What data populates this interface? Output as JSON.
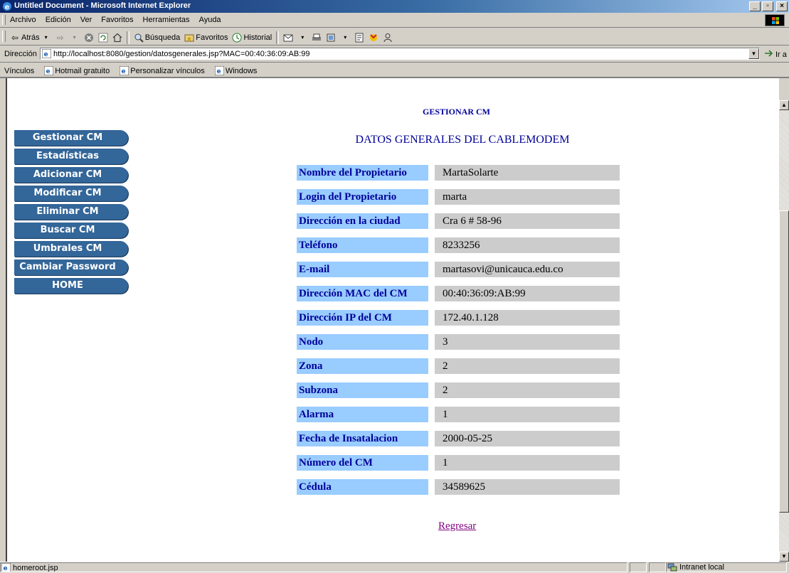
{
  "window": {
    "title": "Untitled Document - Microsoft Internet Explorer",
    "controls": [
      "_",
      "▫",
      "×"
    ]
  },
  "menu": {
    "items": [
      "Archivo",
      "Edición",
      "Ver",
      "Favoritos",
      "Herramientas",
      "Ayuda"
    ]
  },
  "toolbar": {
    "back_label": "Atrás",
    "search_label": "Búsqueda",
    "favorites_label": "Favoritos",
    "history_label": "Historial"
  },
  "address": {
    "label": "Dirección",
    "url": "http://localhost:8080/gestion/datosgenerales.jsp?MAC=00:40:36:09:AB:99",
    "go_label": "Ir a"
  },
  "links": {
    "label": "Vínculos",
    "items": [
      "Hotmail gratuito",
      "Personalizar vínculos",
      "Windows"
    ]
  },
  "nav": {
    "items": [
      "Gestionar CM",
      "Estadísticas",
      "Adicionar CM",
      "Modificar CM",
      "Eliminar CM",
      "Buscar CM",
      "Umbrales CM",
      "Cambiar Password",
      "HOME"
    ]
  },
  "main": {
    "section_title": "GESTIONAR CM",
    "heading": "DATOS GENERALES DEL CABLEMODEM",
    "rows": [
      {
        "label": "Nombre del Propietario",
        "value": "MartaSolarte"
      },
      {
        "label": "Login del Propietario",
        "value": "marta"
      },
      {
        "label": "Dirección en la ciudad",
        "value": "Cra 6 # 58-96"
      },
      {
        "label": "Teléfono",
        "value": "8233256"
      },
      {
        "label": "E-mail",
        "value": "martasovi@unicauca.edu.co"
      },
      {
        "label": "Dirección MAC del CM",
        "value": "00:40:36:09:AB:99"
      },
      {
        "label": "Dirección IP del CM",
        "value": "172.40.1.128"
      },
      {
        "label": "Nodo",
        "value": "3"
      },
      {
        "label": "Zona",
        "value": "2"
      },
      {
        "label": "Subzona",
        "value": "2"
      },
      {
        "label": "Alarma",
        "value": "1"
      },
      {
        "label": "Fecha de Insatalacion",
        "value": "2000-05-25"
      },
      {
        "label": "Número del CM",
        "value": "1"
      },
      {
        "label": "Cédula",
        "value": "34589625"
      }
    ],
    "back_link": "Regresar"
  },
  "status": {
    "text": "homeroot.jsp",
    "zone": "Intranet local"
  },
  "colors": {
    "nav_bg": "#336699",
    "label_bg": "#99ccff",
    "value_bg": "#cccccc",
    "heading": "#000099",
    "visited_link": "#800080"
  }
}
